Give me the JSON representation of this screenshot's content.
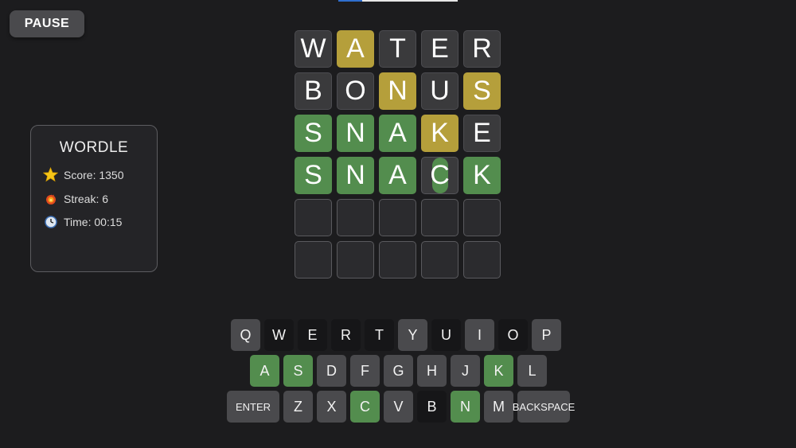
{
  "progress": {
    "fraction": 0.2
  },
  "pause_label": "PAUSE",
  "panel": {
    "title": "WORDLE",
    "score": "Score: 1350",
    "streak": "Streak: 6",
    "time": "Time: 00:15",
    "icons": {
      "score": "star-icon",
      "streak": "fire-icon",
      "time": "clock-icon"
    }
  },
  "colors": {
    "correct": "#538d4e",
    "present": "#b59f3b",
    "absent": "#3a3a3c",
    "background": "#1c1c1e"
  },
  "board": {
    "rows": [
      [
        {
          "l": "W",
          "s": "absent"
        },
        {
          "l": "A",
          "s": "present"
        },
        {
          "l": "T",
          "s": "absent"
        },
        {
          "l": "E",
          "s": "absent"
        },
        {
          "l": "R",
          "s": "absent"
        }
      ],
      [
        {
          "l": "B",
          "s": "absent"
        },
        {
          "l": "O",
          "s": "absent"
        },
        {
          "l": "N",
          "s": "present"
        },
        {
          "l": "U",
          "s": "absent"
        },
        {
          "l": "S",
          "s": "present"
        }
      ],
      [
        {
          "l": "S",
          "s": "correct"
        },
        {
          "l": "N",
          "s": "correct"
        },
        {
          "l": "A",
          "s": "correct"
        },
        {
          "l": "K",
          "s": "present"
        },
        {
          "l": "E",
          "s": "absent"
        }
      ],
      [
        {
          "l": "S",
          "s": "correct"
        },
        {
          "l": "N",
          "s": "correct"
        },
        {
          "l": "A",
          "s": "correct"
        },
        {
          "l": "C",
          "s": "flipping"
        },
        {
          "l": "K",
          "s": "correct"
        }
      ],
      [
        {
          "l": "",
          "s": "empty"
        },
        {
          "l": "",
          "s": "empty"
        },
        {
          "l": "",
          "s": "empty"
        },
        {
          "l": "",
          "s": "empty"
        },
        {
          "l": "",
          "s": "empty"
        }
      ],
      [
        {
          "l": "",
          "s": "empty"
        },
        {
          "l": "",
          "s": "empty"
        },
        {
          "l": "",
          "s": "empty"
        },
        {
          "l": "",
          "s": "empty"
        },
        {
          "l": "",
          "s": "empty"
        }
      ]
    ]
  },
  "keyboard": {
    "rows": [
      [
        {
          "k": "Q",
          "s": "default"
        },
        {
          "k": "W",
          "s": "used"
        },
        {
          "k": "E",
          "s": "used"
        },
        {
          "k": "R",
          "s": "used"
        },
        {
          "k": "T",
          "s": "used"
        },
        {
          "k": "Y",
          "s": "default"
        },
        {
          "k": "U",
          "s": "used"
        },
        {
          "k": "I",
          "s": "default"
        },
        {
          "k": "O",
          "s": "used"
        },
        {
          "k": "P",
          "s": "default"
        }
      ],
      [
        {
          "k": "A",
          "s": "correct"
        },
        {
          "k": "S",
          "s": "correct"
        },
        {
          "k": "D",
          "s": "default"
        },
        {
          "k": "F",
          "s": "default"
        },
        {
          "k": "G",
          "s": "default"
        },
        {
          "k": "H",
          "s": "default"
        },
        {
          "k": "J",
          "s": "default"
        },
        {
          "k": "K",
          "s": "correct"
        },
        {
          "k": "L",
          "s": "default"
        }
      ],
      [
        {
          "k": "ENTER",
          "s": "default",
          "wide": true
        },
        {
          "k": "Z",
          "s": "default"
        },
        {
          "k": "X",
          "s": "default"
        },
        {
          "k": "C",
          "s": "correct"
        },
        {
          "k": "V",
          "s": "default"
        },
        {
          "k": "B",
          "s": "used"
        },
        {
          "k": "N",
          "s": "correct"
        },
        {
          "k": "M",
          "s": "default"
        },
        {
          "k": "BACKSPACE",
          "s": "default",
          "wide": true
        }
      ]
    ]
  }
}
